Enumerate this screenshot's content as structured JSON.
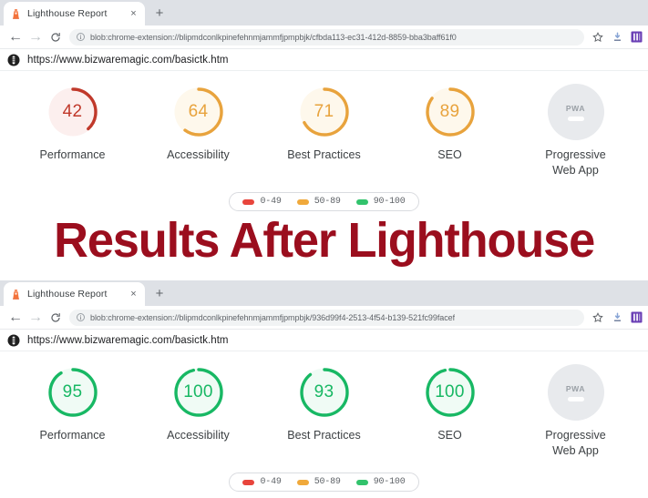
{
  "colors": {
    "red": "#C0392B",
    "red_fill": "#FCEFEE",
    "orange": "#E8A33D",
    "orange_fill": "#FEF8EC",
    "green": "#18B864",
    "green_fill": "#F0FBF5",
    "grey": "#E8EAED",
    "headline_red": "#9B0E1E",
    "tabstrip": "#DEE1E6"
  },
  "headline": {
    "text": "Results After Lighthouse"
  },
  "legend": {
    "items": [
      {
        "range": "0-49",
        "color": "#E8453C"
      },
      {
        "range": "50-89",
        "color": "#F0A93B"
      },
      {
        "range": "90-100",
        "color": "#32C36C"
      }
    ]
  },
  "windows": [
    {
      "id": "before",
      "tab": {
        "title": "Lighthouse Report",
        "close_label": "×",
        "favicon": "lighthouse-icon"
      },
      "newtab_label": "+",
      "toolbar": {
        "back_label": "←",
        "forward_label": "→",
        "reload_label": "C",
        "info_label": "i",
        "url": "blob:chrome-extension://blipmdconlkpinefehnmjammfjpmpbjk/cfbda113-ec31-412d-8859-bba3baff61f0",
        "star_label": "☆"
      },
      "urlline": {
        "text": "https://www.bizwaremagic.com/basictk.htm"
      },
      "gauges": [
        {
          "label": "Performance",
          "score": "42",
          "value": 42,
          "state": "red"
        },
        {
          "label": "Accessibility",
          "score": "64",
          "value": 64,
          "state": "orange"
        },
        {
          "label": "Best Practices",
          "score": "71",
          "value": 71,
          "state": "orange"
        },
        {
          "label": "SEO",
          "score": "89",
          "value": 89,
          "state": "orange"
        },
        {
          "label": "Progressive\nWeb App",
          "score": "PWA",
          "value": null,
          "state": "pwa"
        }
      ]
    },
    {
      "id": "after",
      "tab": {
        "title": "Lighthouse Report",
        "close_label": "×",
        "favicon": "lighthouse-icon"
      },
      "newtab_label": "+",
      "toolbar": {
        "back_label": "←",
        "forward_label": "→",
        "reload_label": "C",
        "info_label": "i",
        "url": "blob:chrome-extension://blipmdconlkpinefehnmjammfjpmpbjk/936d99f4-2513-4f54-b139-521fc99facef",
        "star_label": "☆"
      },
      "urlline": {
        "text": "https://www.bizwaremagic.com/basictk.htm"
      },
      "gauges": [
        {
          "label": "Performance",
          "score": "95",
          "value": 95,
          "state": "green"
        },
        {
          "label": "Accessibility",
          "score": "100",
          "value": 100,
          "state": "green"
        },
        {
          "label": "Best Practices",
          "score": "93",
          "value": 93,
          "state": "green"
        },
        {
          "label": "SEO",
          "score": "100",
          "value": 100,
          "state": "green"
        },
        {
          "label": "Progressive\nWeb App",
          "score": "PWA",
          "value": null,
          "state": "pwa"
        }
      ]
    }
  ]
}
